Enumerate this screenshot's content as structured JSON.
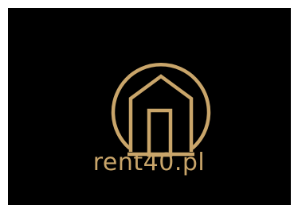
{
  "brand": {
    "name": "rent40.pl",
    "icon": "house-in-circle-icon"
  },
  "colors": {
    "background": "#000000",
    "frame": "#ffffff",
    "accent": "#c9a56a"
  }
}
